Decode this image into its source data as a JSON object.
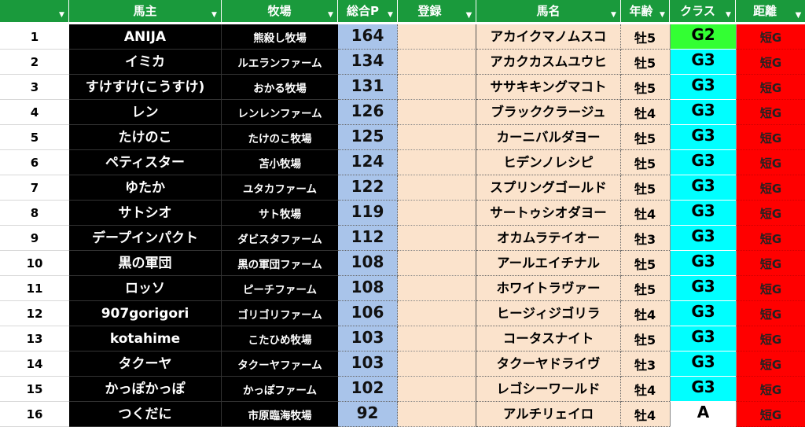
{
  "colors": {
    "header_bg": "#1a9a3c",
    "owner_bg": "#000000",
    "points_bg": "#a9c4ea",
    "peach_bg": "#fbe3cc",
    "class_g2": "#33ff33",
    "class_g3": "#00ffff",
    "class_a": "#ffffff",
    "distance_bg": "#ff0000"
  },
  "header": {
    "owner": "馬主",
    "farm": "牧場",
    "points": "総合P",
    "registration": "登録",
    "horse": "馬名",
    "age": "年齢",
    "class": "クラス",
    "distance": "距離"
  },
  "rows": [
    {
      "num": "1",
      "owner": "ANIJA",
      "farm": "熊殺し牧場",
      "points": "164",
      "horse": "アカイクマノムスコ",
      "age": "牡5",
      "class": "G2",
      "class_color": "#33ff33",
      "distance": "短G"
    },
    {
      "num": "2",
      "owner": "イミカ",
      "farm": "ルエランファーム",
      "points": "134",
      "horse": "アカクカスムユウヒ",
      "age": "牡5",
      "class": "G3",
      "class_color": "#00ffff",
      "distance": "短G"
    },
    {
      "num": "3",
      "owner": "すけすけ(こうすけ)",
      "farm": "おかる牧場",
      "points": "131",
      "horse": "ササキキングマコト",
      "age": "牡5",
      "class": "G3",
      "class_color": "#00ffff",
      "distance": "短G"
    },
    {
      "num": "4",
      "owner": "レン",
      "farm": "レンレンファーム",
      "points": "126",
      "horse": "ブラッククラージュ",
      "age": "牡4",
      "class": "G3",
      "class_color": "#00ffff",
      "distance": "短G"
    },
    {
      "num": "5",
      "owner": "たけのこ",
      "farm": "たけのこ牧場",
      "points": "125",
      "horse": "カーニバルダヨー",
      "age": "牡5",
      "class": "G3",
      "class_color": "#00ffff",
      "distance": "短G"
    },
    {
      "num": "6",
      "owner": "ペティスター",
      "farm": "苫小牧場",
      "points": "124",
      "horse": "ヒデンノレシピ",
      "age": "牡5",
      "class": "G3",
      "class_color": "#00ffff",
      "distance": "短G"
    },
    {
      "num": "7",
      "owner": "ゆたか",
      "farm": "ユタカファーム",
      "points": "122",
      "horse": "スプリングゴールド",
      "age": "牡5",
      "class": "G3",
      "class_color": "#00ffff",
      "distance": "短G"
    },
    {
      "num": "8",
      "owner": "サトシオ",
      "farm": "サト牧場",
      "points": "119",
      "horse": "サートゥシオダヨー",
      "age": "牡4",
      "class": "G3",
      "class_color": "#00ffff",
      "distance": "短G"
    },
    {
      "num": "9",
      "owner": "デープインパクト",
      "farm": "ダビスタファーム",
      "points": "112",
      "horse": "オカムラテイオー",
      "age": "牡3",
      "class": "G3",
      "class_color": "#00ffff",
      "distance": "短G"
    },
    {
      "num": "10",
      "owner": "黒の軍団",
      "farm": "黒の軍団ファーム",
      "points": "108",
      "horse": "アールエイチナル",
      "age": "牡5",
      "class": "G3",
      "class_color": "#00ffff",
      "distance": "短G"
    },
    {
      "num": "11",
      "owner": "ロッソ",
      "farm": "ピーチファーム",
      "points": "108",
      "horse": "ホワイトラヴァー",
      "age": "牡5",
      "class": "G3",
      "class_color": "#00ffff",
      "distance": "短G"
    },
    {
      "num": "12",
      "owner": "907gorigori",
      "farm": "ゴリゴリファーム",
      "points": "106",
      "horse": "ヒージィジゴリラ",
      "age": "牡4",
      "class": "G3",
      "class_color": "#00ffff",
      "distance": "短G"
    },
    {
      "num": "13",
      "owner": "kotahime",
      "farm": "こたひめ牧場",
      "points": "103",
      "horse": "コータスナイト",
      "age": "牡5",
      "class": "G3",
      "class_color": "#00ffff",
      "distance": "短G"
    },
    {
      "num": "14",
      "owner": "タクーヤ",
      "farm": "タクーヤファーム",
      "points": "103",
      "horse": "タクーヤドライヴ",
      "age": "牡3",
      "class": "G3",
      "class_color": "#00ffff",
      "distance": "短G"
    },
    {
      "num": "15",
      "owner": "かっぽかっぽ",
      "farm": "かっぽファーム",
      "points": "102",
      "horse": "レゴシーワールド",
      "age": "牡4",
      "class": "G3",
      "class_color": "#00ffff",
      "distance": "短G"
    },
    {
      "num": "16",
      "owner": "つくだに",
      "farm": "市原臨海牧場",
      "points": "92",
      "horse": "アルチリェイロ",
      "age": "牡4",
      "class": "A",
      "class_color": "#ffffff",
      "distance": "短G"
    }
  ]
}
